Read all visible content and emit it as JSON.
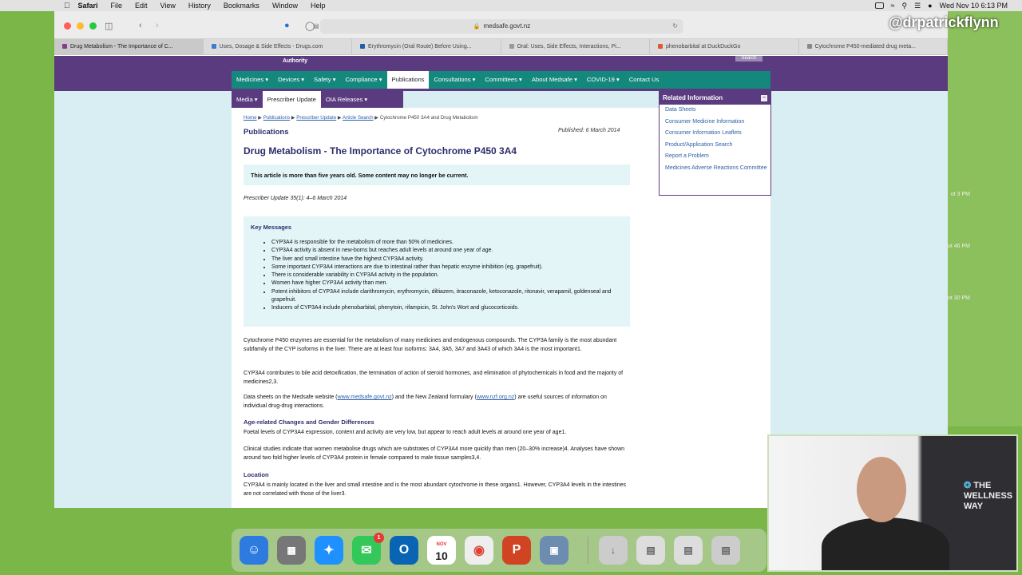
{
  "menubar": {
    "app": "Safari",
    "items": [
      "File",
      "Edit",
      "View",
      "History",
      "Bookmarks",
      "Window",
      "Help"
    ],
    "datetime": "Wed Nov 10  6:13 PM"
  },
  "browser": {
    "url": "medsafe.govt.nz",
    "tabs": [
      "Drug Metabolism - The Importance of C...",
      "Uses, Dosage & Side Effects - Drugs.com",
      "Erythromycin (Oral Route) Before Using...",
      "Oral: Uses, Side Effects, Interactions, Pi...",
      "phenobarbital at DuckDuckGo",
      "Cytochrome P450-mediated drug meta..."
    ]
  },
  "site": {
    "authority": "Authority",
    "search": "Search",
    "nav": [
      "Medicines",
      "Devices",
      "Safety",
      "Compliance",
      "Publications",
      "Consultations",
      "Committees",
      "About Medsafe",
      "COVID-19",
      "Contact Us"
    ],
    "subnav": [
      "Media",
      "Prescriber Update",
      "OIA Releases"
    ]
  },
  "article": {
    "breadcrumb": [
      "Home",
      "Publications",
      "Prescriber Update",
      "Article Search",
      "Cytochrome P450 3A4 and Drug Metabolism"
    ],
    "section": "Publications",
    "published": "Published: 6 March 2014",
    "title": "Drug Metabolism - The Importance of Cytochrome P450 3A4",
    "notice": "This article is more than five years old. Some content may no longer be current.",
    "citation": "Prescriber Update 35(1): 4–6 March 2014",
    "key_heading": "Key Messages",
    "key_messages": [
      "CYP3A4 is responsible for the metabolism of more than 50% of medicines.",
      "CYP3A4 activity is absent in new-borns but reaches adult levels at around one year of age.",
      "The liver and small intestine have the highest CYP3A4 activity.",
      "Some important CYP3A4 interactions are due to intestinal rather than hepatic enzyme inhibition (eg, grapefruit).",
      "There is considerable variability in CYP3A4 activity in the population.",
      "Women have higher CYP3A4 activity than men.",
      "Potent inhibitors of CYP3A4 include clarithromycin, erythromycin, diltiazem, itraconazole, ketoconazole, ritonavir, verapamil, goldenseal and grapefruit.",
      "Inducers of CYP3A4 include phenobarbital, phenytoin, rifampicin, St. John's Wort and glucocorticoids."
    ],
    "p1": "Cytochrome P450 enzymes are essential for the metabolism of many medicines and endogenous compounds. The CYP3A family is the most abundant subfamily of the CYP isoforms in the liver. There are at least four isoforms: 3A4, 3A5, 3A7 and 3A43 of which 3A4 is the most important1.",
    "p2": "CYP3A4 contributes to bile acid detoxification, the termination of action of steroid hormones, and elimination of phytochemicals in food and the majority of medicines2,3.",
    "p3a": "Data sheets on the Medsafe website (",
    "p3link1": "www.medsafe.govt.nz",
    "p3b": ") and the New Zealand formulary (",
    "p3link2": "www.nzf.org.nz",
    "p3c": ") are useful sources of information on individual drug-drug interactions.",
    "h_age": "Age-related Changes and Gender Differences",
    "p4": "Foetal levels of CYP3A4 expression, content and activity are very low, but appear to reach adult levels at around one year of age1.",
    "p5": "Clinical studies indicate that women metabolise drugs which are substrates of CYP3A4 more quickly than men (20–30% increase)4. Analyses have shown around two fold higher levels of CYP3A4 protein in female compared to male tissue samples3,4.",
    "h_loc": "Location",
    "p6": "CYP3A4 is mainly located in the liver and small intestine and is the most abundant cytochrome in these organs1. However, CYP3A4 levels in the intestines are not correlated with those of the liver3."
  },
  "related": {
    "heading": "Related Information",
    "items": [
      "Data Sheets",
      "Consumer Medicine Information",
      "Consumer Information Leaflets",
      "Product/Application Search",
      "Report a Problem",
      "Medicines Adverse Reactions Committee"
    ]
  },
  "dock": {
    "calendar_month": "NOV",
    "calendar_day": "10",
    "messages_badge": "1"
  },
  "overlay": {
    "watermark": "@drpatrickflynn",
    "brand_line1": "THE",
    "brand_line2": "WELLNESS",
    "brand_line3": "WAY"
  },
  "desktop": {
    "labels": [
      "ot 3 PM",
      "ot 46 PM",
      "ot 30 PM"
    ]
  },
  "colors": {
    "medsafe_purple": "#5b3b7f",
    "medsafe_teal": "#14887d",
    "desktop_green": "#7ab648"
  }
}
